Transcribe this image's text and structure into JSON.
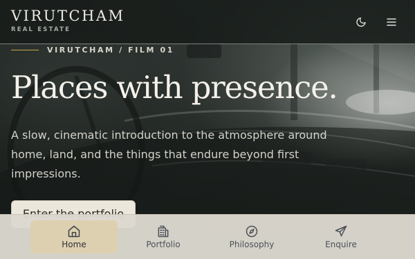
{
  "header": {
    "brand_name": "VIRUTCHAM",
    "brand_tagline": "REAL ESTATE",
    "theme_toggle_icon": "moon-icon",
    "menu_icon": "hamburger-menu-icon"
  },
  "hero": {
    "kicker": "VIRUTCHAM / FILM 01",
    "headline": "Places with presence.",
    "intro": "A slow, cinematic introduction to the atmosphere around home, land, and the things that endure beyond first impressions.",
    "cta_label": "Enter the portfolio"
  },
  "bottom_nav": {
    "items": [
      {
        "label": "Home",
        "icon": "home-icon",
        "active": true
      },
      {
        "label": "Portfolio",
        "icon": "building-icon",
        "active": false
      },
      {
        "label": "Philosophy",
        "icon": "compass-icon",
        "active": false
      },
      {
        "label": "Enquire",
        "icon": "send-icon",
        "active": false
      }
    ]
  },
  "colors": {
    "accent": "#c9a84a",
    "topbar_bg": "#161b19",
    "nav_bg": "#ddd9cf",
    "nav_active_bg": "#ddd0b1",
    "cta_bg": "#ece7db"
  }
}
